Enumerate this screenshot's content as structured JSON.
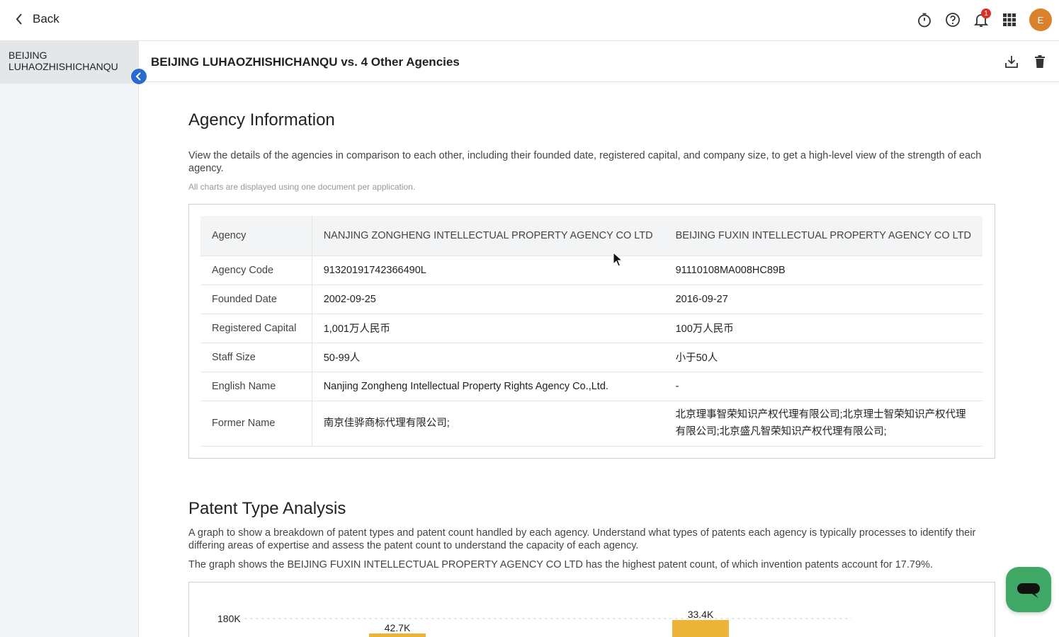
{
  "topbar": {
    "back_label": "Back",
    "notification_count": "1",
    "avatar_initial": "E"
  },
  "sidebar": {
    "items": [
      {
        "label": "BEIJING LUHAOZHISHICHANQU"
      }
    ]
  },
  "header": {
    "title": "BEIJING LUHAOZHISHICHANQU vs. 4 Other Agencies"
  },
  "agency_info": {
    "title": "Agency Information",
    "description": "View the details of the agencies in comparison to each other, including their founded date, registered capital, and company size, to get a high-level view of the strength of each agency.",
    "note": "All charts are displayed using one document per application.",
    "table": {
      "headers": [
        "Agency",
        "NANJING ZONGHENG INTELLECTUAL PROPERTY AGENCY CO LTD",
        "BEIJING FUXIN INTELLECTUAL PROPERTY AGENCY CO LTD"
      ],
      "rows": [
        [
          "Agency Code",
          "91320191742366490L",
          "91110108MA008HC89B"
        ],
        [
          "Founded Date",
          "2002-09-25",
          "2016-09-27"
        ],
        [
          "Registered Capital",
          "1,001万人民币",
          "100万人民币"
        ],
        [
          "Staff Size",
          "50-99人",
          "小于50人"
        ],
        [
          "English Name",
          "Nanjing Zongheng Intellectual Property Rights Agency Co.,Ltd.",
          "-"
        ],
        [
          "Former Name",
          "南京佳骅商标代理有限公司;",
          "北京理事智荣知识产权代理有限公司;北京理士智荣知识产权代理有限公司;北京盛凡智荣知识产权代理有限公司;"
        ]
      ]
    }
  },
  "patent_type": {
    "title": "Patent Type Analysis",
    "description": "A graph to show a breakdown of patent types and patent count handled by each agency. Understand what types of patents each agency is typically processes to identify their differing areas of expertise and assess the patent count to understand the capacity of each agency.",
    "summary": "The graph shows the BEIJING FUXIN INTELLECTUAL PROPERTY AGENCY CO LTD has the highest patent count, of which invention patents account for 17.79%.",
    "chart": {
      "y_tick_top": "180K",
      "y_max": 180000,
      "bars": [
        {
          "label": "42.7K"
        },
        {
          "label": "33.4K"
        }
      ],
      "bar_color": "#ecb53a"
    }
  },
  "colors": {
    "accent": "#2a6ad3",
    "chat": "#3fa864",
    "avatar": "#d9822b"
  }
}
